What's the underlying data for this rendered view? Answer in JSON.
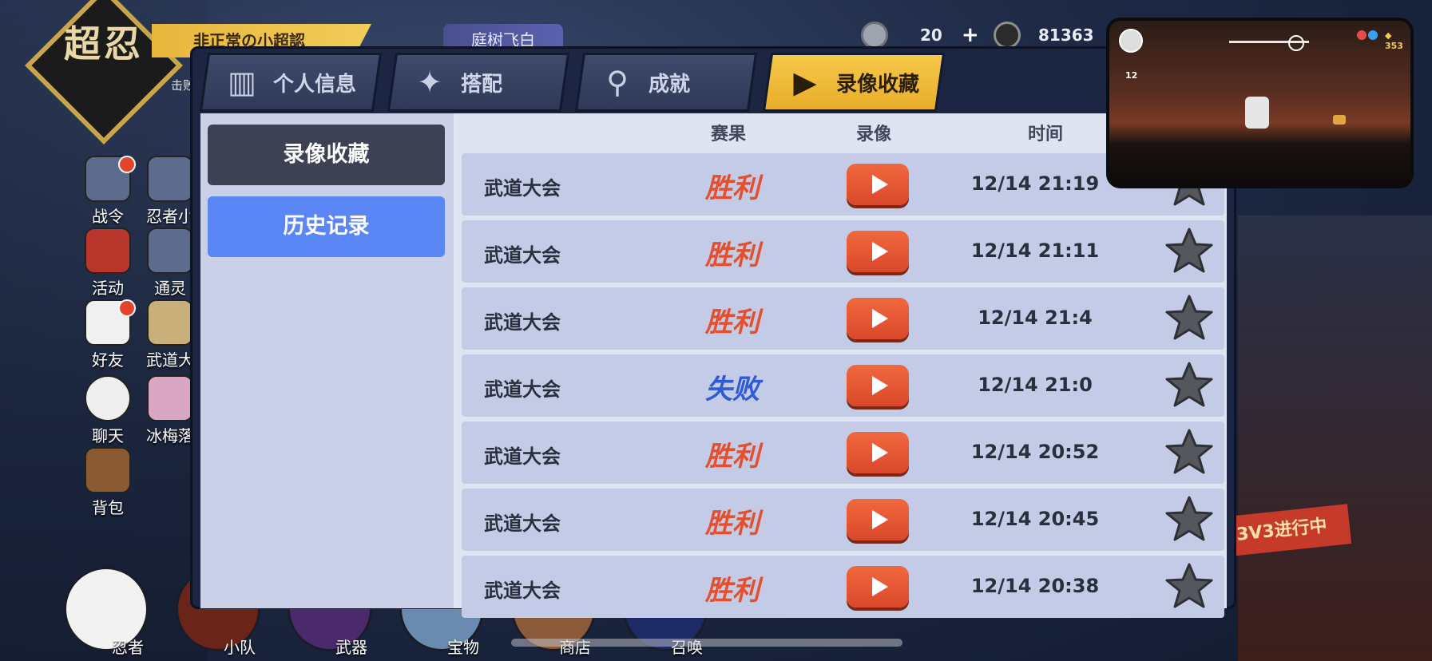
{
  "background": {
    "logo_text": "超忍",
    "player_name": "非正常の小超認",
    "player_sub": "击败",
    "guild_name": "庭树飞白",
    "currencies": [
      {
        "name": "silver-coin",
        "value": "20"
      },
      {
        "name": "gold-coin",
        "value": "81363"
      }
    ],
    "side_menu": [
      {
        "label": "战令",
        "dot": true
      },
      {
        "label": "忍者小",
        "dot": false
      },
      {
        "label": "活动",
        "dot": false
      },
      {
        "label": "通灵",
        "dot": false
      },
      {
        "label": "好友",
        "dot": true
      },
      {
        "label": "武道大",
        "dot": false
      },
      {
        "label": "聊天",
        "dot": false
      },
      {
        "label": "冰梅落",
        "dot": false
      },
      {
        "label": "背包",
        "dot": false
      }
    ],
    "bottom_nav": [
      "忍者",
      "小队",
      "武器",
      "宝物",
      "商店",
      "召唤"
    ],
    "right_banner": "3V3进行中"
  },
  "tabs": [
    {
      "label": "个人信息",
      "icon": "id-card-icon",
      "active": false
    },
    {
      "label": "搭配",
      "icon": "shuriken-icon",
      "active": false
    },
    {
      "label": "成就",
      "icon": "trophy-icon",
      "active": false
    },
    {
      "label": "录像收藏",
      "icon": "play-icon",
      "active": true
    }
  ],
  "sub_nav": {
    "favorites": "录像收藏",
    "history": "历史记录",
    "active": "history"
  },
  "table": {
    "headers": {
      "result": "赛果",
      "replay": "录像",
      "time": "时间"
    },
    "rows": [
      {
        "mode": "武道大会",
        "result": "胜利",
        "outcome": "win",
        "time": "12/14 21:19"
      },
      {
        "mode": "武道大会",
        "result": "胜利",
        "outcome": "win",
        "time": "12/14 21:11"
      },
      {
        "mode": "武道大会",
        "result": "胜利",
        "outcome": "win",
        "time": "12/14 21:4"
      },
      {
        "mode": "武道大会",
        "result": "失败",
        "outcome": "lose",
        "time": "12/14 21:0"
      },
      {
        "mode": "武道大会",
        "result": "胜利",
        "outcome": "win",
        "time": "12/14 20:52"
      },
      {
        "mode": "武道大会",
        "result": "胜利",
        "outcome": "win",
        "time": "12/14 20:45"
      },
      {
        "mode": "武道大会",
        "result": "胜利",
        "outcome": "win",
        "time": "12/14 20:38"
      }
    ]
  },
  "pip": {
    "level": "12",
    "gold": "353"
  },
  "colors": {
    "accent_tab": "#f3c244",
    "history_button": "#5b86f6",
    "play_button": "#e4552f",
    "win_text": "#e4502e",
    "lose_text": "#2f5bd6"
  }
}
